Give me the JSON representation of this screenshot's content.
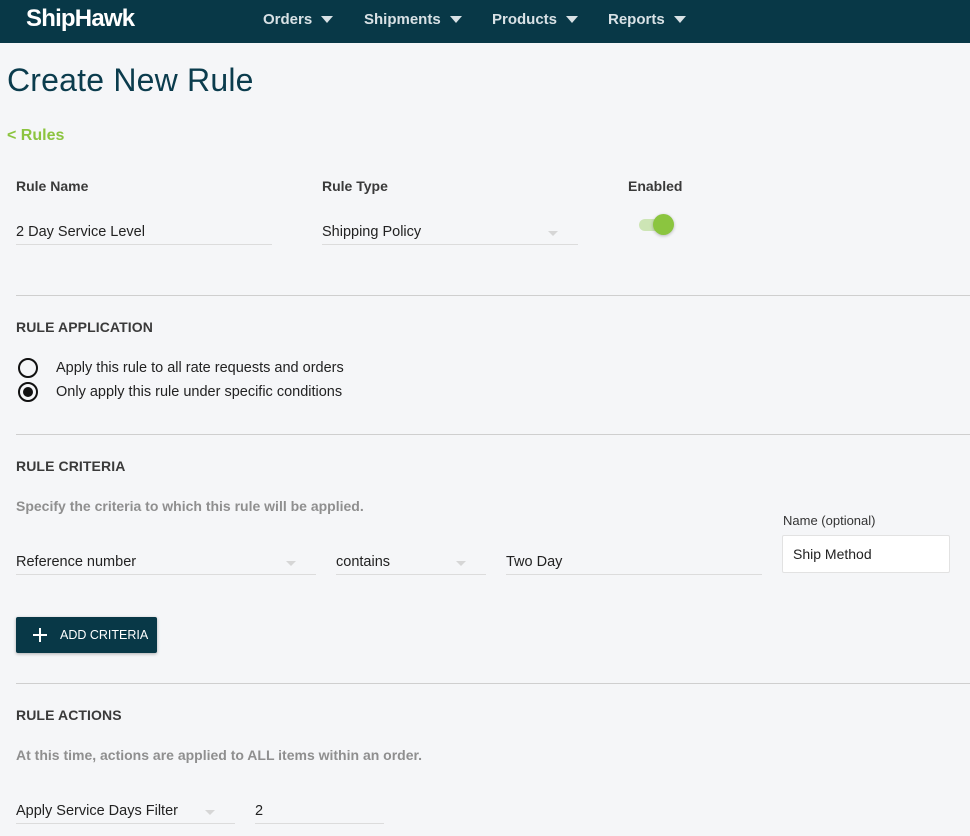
{
  "nav": {
    "logo": "ShipHawk",
    "items": [
      {
        "label": "Orders"
      },
      {
        "label": "Shipments"
      },
      {
        "label": "Products"
      },
      {
        "label": "Reports"
      }
    ]
  },
  "page": {
    "title": "Create New Rule",
    "back_link": "< Rules"
  },
  "rule_info": {
    "name_label": "Rule Name",
    "name_value": "2 Day Service Level",
    "type_label": "Rule Type",
    "type_value": "Shipping Policy",
    "enabled_label": "Enabled",
    "enabled": true
  },
  "rule_application": {
    "title": "RULE APPLICATION",
    "options": [
      {
        "label": "Apply this rule to all rate requests and orders",
        "checked": false
      },
      {
        "label": "Only apply this rule under specific conditions",
        "checked": true
      }
    ]
  },
  "rule_criteria": {
    "title": "RULE CRITERIA",
    "hint": "Specify the criteria to which this rule will be applied.",
    "field_value": "Reference number",
    "operator_value": "contains",
    "match_value": "Two Day",
    "name_label": "Name (optional)",
    "name_value": "Ship Method",
    "add_button": "ADD CRITERIA"
  },
  "rule_actions": {
    "title": "RULE ACTIONS",
    "hint": "At this time, actions are applied to ALL items within an order.",
    "action_value": "Apply Service Days Filter",
    "action_param": "2"
  },
  "colors": {
    "nav_bg": "#083847",
    "accent_green": "#8bc53f",
    "title_color": "#0b3c4d"
  }
}
